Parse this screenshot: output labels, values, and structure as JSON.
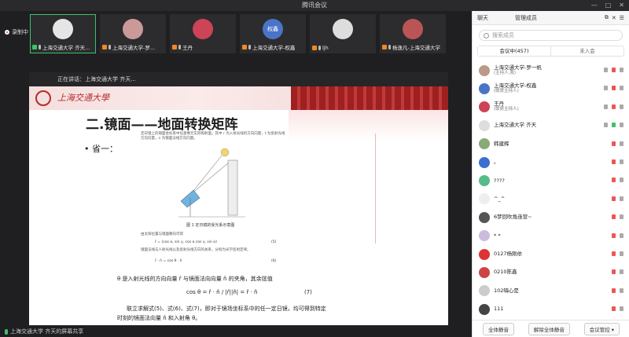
{
  "window": {
    "title": "腾讯会议"
  },
  "recording": {
    "label": "录制中"
  },
  "tiles": [
    {
      "label": "上海交通大学 齐天...",
      "color": "#e5e5e5",
      "active": true,
      "badge": "g"
    },
    {
      "label": "上海交通大学-罗...",
      "color": "#c99",
      "active": false,
      "badge": "o"
    },
    {
      "label": "王丹",
      "color": "#c45",
      "active": false,
      "badge": "o"
    },
    {
      "label": "上海交通大学-权鑫",
      "color": "#4a74c8",
      "active": false,
      "badge": "o",
      "avatar_text": "权鑫"
    },
    {
      "label": "ljh",
      "color": "#ddd",
      "active": false,
      "badge": "o"
    },
    {
      "label": "杨逸凡-上海交通大学",
      "color": "#b55",
      "active": false,
      "badge": "o"
    }
  ],
  "share_bar": {
    "text": "正在讲话：上海交通大学 齐天..."
  },
  "slide": {
    "school": "上海交通大學",
    "title": "二.镜面——地面转换矩阵",
    "bullet": "• 省一：",
    "para1": "定日镜上的镜面坐标系中任意像元实际照射面，其中 r 为入射光线的方向向量，t 为反射光线方向向量，n 为镜面法线方向向量。",
    "figure_caption": "图 1  定日镜的受光系示意图",
    "para2": "由太阳位置与镜面朝向可得",
    "eq1": "r̂ = (cos α, sin γ, cos α cos γ, sin α)",
    "eq1_num": "(5)",
    "para3": "镜面法线与人射光线以及反射光线方向的关系，分别为光学反射定律。",
    "eq2": "r̂ · n̂ = cos θ · n̂",
    "eq2_num": "(6)",
    "line1": "θ 是入射光线的方向向量 r̂ 与镜面法向向量 n̂ 的夹角，其余弦值",
    "eq3": "cos θ = r̂ · n̂ / |r̂||n̂| = r̂ · n̂",
    "eq3_num": "(7)",
    "line2": "联立求解式(5)、式(6)、式(7)，即对于镜场坐标系中的任一定日镜，均可得到特定",
    "line3": "时刻的镜面法向量 n̂ 和入射角 θ。"
  },
  "stage_footer": {
    "text": "上海交通大学 齐天的屏幕共享"
  },
  "panel": {
    "tab_chat": "聊天",
    "tab_manage": "管理成员",
    "search_placeholder": "搜索成员",
    "tab_in_meeting": "会议中(457)",
    "tab_not_joined": "未入会",
    "members": [
      {
        "name": "上海交通大学-罗一帆",
        "role": "(主持人,我)",
        "color": "#b98"
      },
      {
        "name": "上海交通大学-权鑫",
        "role": "(联席主持人)",
        "color": "#4a74c8"
      },
      {
        "name": "王丹",
        "role": "(联席主持人)",
        "color": "#c45"
      },
      {
        "name": "上海交通大学 齐天",
        "role": "",
        "color": "#ddd"
      },
      {
        "name": "韩建辉",
        "role": "",
        "color": "#8a7"
      },
      {
        "name": "。",
        "role": "",
        "color": "#3a6fd0"
      },
      {
        "name": "????",
        "role": "",
        "color": "#5b8"
      },
      {
        "name": "^_^",
        "role": "",
        "color": "#eee"
      },
      {
        "name": "6梦回吹角连营~",
        "role": "",
        "color": "#555"
      },
      {
        "name": "* *",
        "role": "",
        "color": "#cbd"
      },
      {
        "name": "0127杨刚依",
        "role": "",
        "color": "#d33"
      },
      {
        "name": "0210陈鑫",
        "role": "",
        "color": "#c44"
      },
      {
        "name": "102嗨心是",
        "role": "",
        "color": "#ccc"
      },
      {
        "name": "111",
        "role": "",
        "color": "#444"
      }
    ],
    "btn_mute_all": "全体静音",
    "btn_unmute_all": "解除全体静音",
    "btn_control": "会议管控 ▾"
  }
}
